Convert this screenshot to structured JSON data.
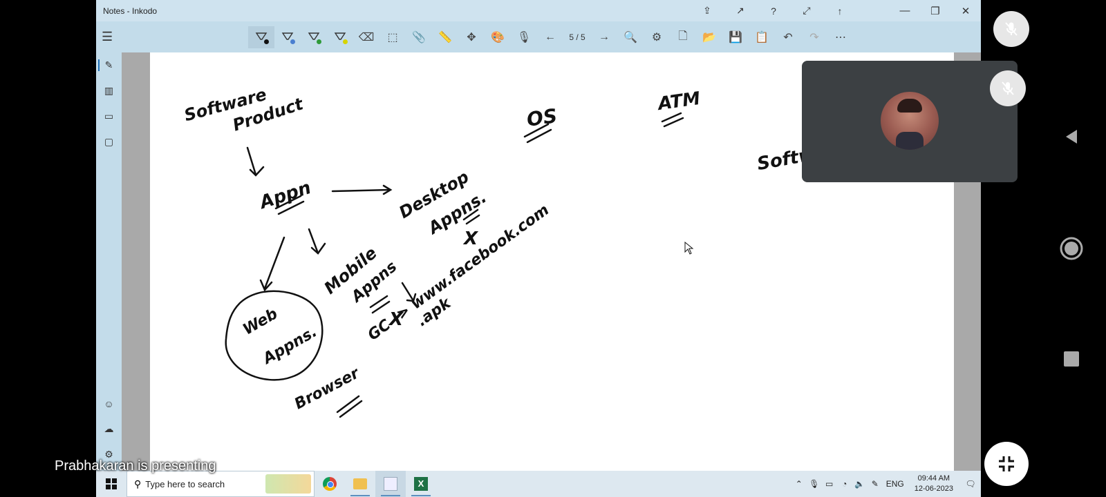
{
  "window": {
    "title": "Notes - Inkodo"
  },
  "toolbar": {
    "page_indicator": "5 / 5"
  },
  "canvas_text": {
    "software_product_1": "Software",
    "software_product_2": "Product",
    "apps": "Appn",
    "desktop_1": "Desktop",
    "desktop_2": "Appns.",
    "mobile_1": "Mobile",
    "mobile_2": "Appns",
    "web_1": "Web",
    "web_2": "Appns.",
    "apk": ".apk",
    "x_mark": "X",
    "browser": "Browser",
    "url_line": "GC -> www.facebook.com",
    "os": "OS",
    "atm": "ATM",
    "software_partial": "Softw"
  },
  "taskbar": {
    "search_placeholder": "Type here to search",
    "lang": "ENG",
    "time": "09:44 AM",
    "date": "12-06-2023"
  },
  "meeting": {
    "presenting_label": "Prabhakaran is presenting"
  },
  "colors": {
    "titlebar": "#cfe3ef",
    "toolbar": "#c3dcea",
    "canvas": "#ffffff",
    "tile": "#3c4043"
  }
}
